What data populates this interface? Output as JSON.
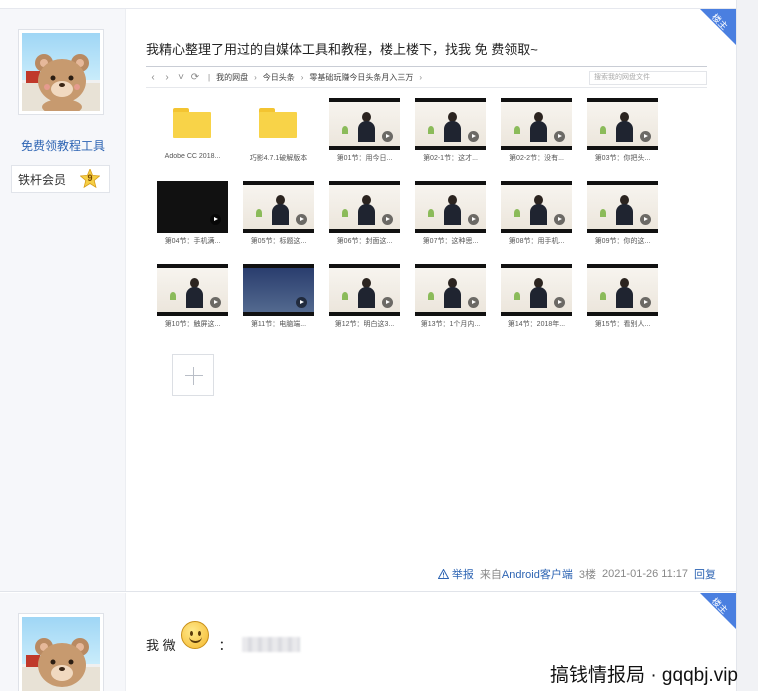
{
  "post1": {
    "badge": "楼主",
    "username": "免费领教程工具",
    "member_label": "铁杆会员",
    "member_level": "9",
    "text": "我精心整理了用过的自媒体工具和教程，楼上楼下，找我 免 费领取~",
    "pan": {
      "breadcrumbs": [
        "我的网盘",
        "今日头条",
        "零基础玩赚今日头条月入三万"
      ],
      "search_placeholder": "搜索我的网盘文件",
      "rows": [
        [
          {
            "type": "folder",
            "label": "Adobe CC 2018..."
          },
          {
            "type": "folder",
            "label": "巧影4.7.1破解版本"
          },
          {
            "type": "video",
            "label": "第01节：用今日..."
          },
          {
            "type": "video",
            "label": "第02-1节：这才..."
          },
          {
            "type": "video",
            "label": "第02-2节：没有..."
          },
          {
            "type": "video",
            "label": "第03节：你把头..."
          }
        ],
        [
          {
            "type": "video",
            "variant": "dark",
            "label": "第04节：手机满..."
          },
          {
            "type": "video",
            "label": "第05节：标题这..."
          },
          {
            "type": "video",
            "label": "第06节：封面这..."
          },
          {
            "type": "video",
            "label": "第07节：这种思..."
          },
          {
            "type": "video",
            "label": "第08节：用手机..."
          },
          {
            "type": "video",
            "label": "第09节：你的这..."
          }
        ],
        [
          {
            "type": "video",
            "label": "第10节：触屏这..."
          },
          {
            "type": "video",
            "variant": "screen",
            "label": "第11节：电脑端..."
          },
          {
            "type": "video",
            "label": "第12节：明白这3..."
          },
          {
            "type": "video",
            "label": "第13节：1个月内..."
          },
          {
            "type": "video",
            "label": "第14节：2018年..."
          },
          {
            "type": "video",
            "label": "第15节：看别人..."
          }
        ]
      ]
    },
    "footer": {
      "report": "举报",
      "source_prefix": "来自",
      "source_client": "Android客户端",
      "floor": "3楼",
      "timestamp": "2021-01-26 11:17",
      "reply": "回复"
    }
  },
  "post2": {
    "badge": "楼主",
    "text_prefix": "我 微",
    "colon": "："
  },
  "watermark": "搞钱情报局 · gqqbj.vip",
  "colors": {
    "link": "#2d64b3",
    "badge": "#4a7fe0",
    "sidebar_bg": "#f6f7fa"
  }
}
